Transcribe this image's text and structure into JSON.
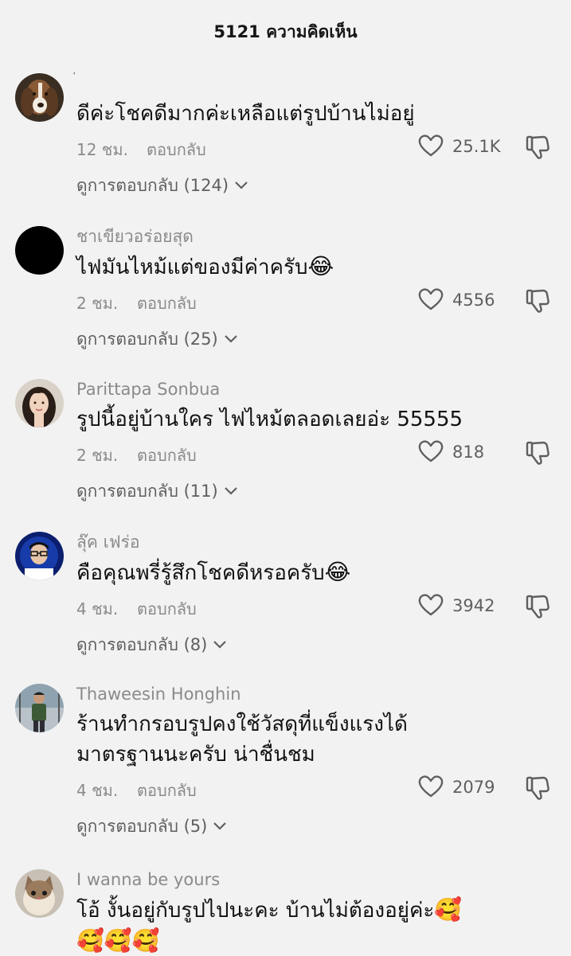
{
  "header": {
    "title": "5121 ความคิดเห็น"
  },
  "comments": [
    {
      "username": "่",
      "text": "ดีค่ะโชคดีมากค่ะเหลือแต่รูปบ้านไม่อยู่",
      "time": "12 ชม.",
      "reply": "ตอบกลับ",
      "likes": "25.1K",
      "view_replies": "ดูการตอบกลับ (124)",
      "avatar": "basset-hound-dog"
    },
    {
      "username": "ชาเขียวอร่อยสุด",
      "text": "ไฟมันไหม้แต่ของมีค่าครับ",
      "emoji": "😂",
      "time": "2 ชม.",
      "reply": "ตอบกลับ",
      "likes": "4556",
      "view_replies": "ดูการตอบกลับ (25)",
      "avatar": "black-circle"
    },
    {
      "username": "Parittapa Sonbua",
      "text": "รูปนี้อยู่บ้านใคร ไฟไหม้ตลอดเลยอ่ะ 55555",
      "time": "2 ชม.",
      "reply": "ตอบกลับ",
      "likes": "818",
      "view_replies": "ดูการตอบกลับ (11)",
      "avatar": "woman-portrait"
    },
    {
      "username": "ลุ๊ค เฟร่อ",
      "text": "คือคุณพรี่รู้สึกโชคดีหรอครับ",
      "emoji": "😂",
      "time": "4 ชม.",
      "reply": "ตอบกลับ",
      "likes": "3942",
      "view_replies": "ดูการตอบกลับ (8)",
      "avatar": "man-glasses-blue"
    },
    {
      "username": "Thaweesin Honghin",
      "text_line1": "ร้านทำกรอบรูปคงใช้วัสดุที่แข็งแรงได้",
      "text_line2": "มาตรฐานนะครับ น่าชื่นชม",
      "time": "4 ชม.",
      "reply": "ตอบกลับ",
      "likes": "2079",
      "view_replies": "ดูการตอบกลับ (5)",
      "avatar": "man-standing"
    },
    {
      "username": "I wanna be yours",
      "text": "โอ้ งั้นอยู่กับรูปไปนะคะ บ้านไม่ต้องอยู่ค่ะ",
      "emoji": "🥰",
      "emoji_line2": "🥰🥰🥰",
      "avatar": "cat-doll"
    }
  ],
  "icons": {
    "like": "heart-outline-icon",
    "dislike": "thumbs-down-outline-icon",
    "chevron": "chevron-down-icon"
  }
}
